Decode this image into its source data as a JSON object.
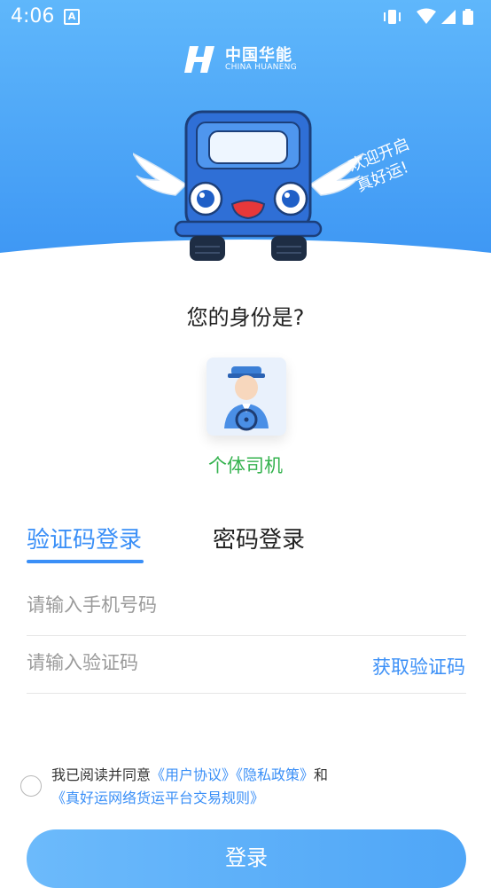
{
  "status_bar": {
    "time": "4:06",
    "notification_icon": "A"
  },
  "brand": {
    "name_cn": "中国华能",
    "name_en": "CHINA HUANENG"
  },
  "hero": {
    "welcome_line1": "欢迎开启",
    "welcome_line2": "真好运!"
  },
  "identity": {
    "title": "您的身份是?",
    "role_label": "个体司机"
  },
  "tabs": {
    "sms_login": "验证码登录",
    "password_login": "密码登录"
  },
  "form": {
    "phone_placeholder": "请输入手机号码",
    "code_placeholder": "请输入验证码",
    "get_code": "获取验证码"
  },
  "agreement": {
    "prefix": "我已阅读并同意",
    "user_agreement": "《用户协议》",
    "privacy_policy": "《隐私政策》",
    "and": "和",
    "trade_rules": "《真好运网络货运平台交易规则》"
  },
  "login_button": "登录",
  "colors": {
    "primary": "#3a8ff7",
    "accent_green": "#34b24e",
    "hero_blue": "#4aa4f6"
  }
}
